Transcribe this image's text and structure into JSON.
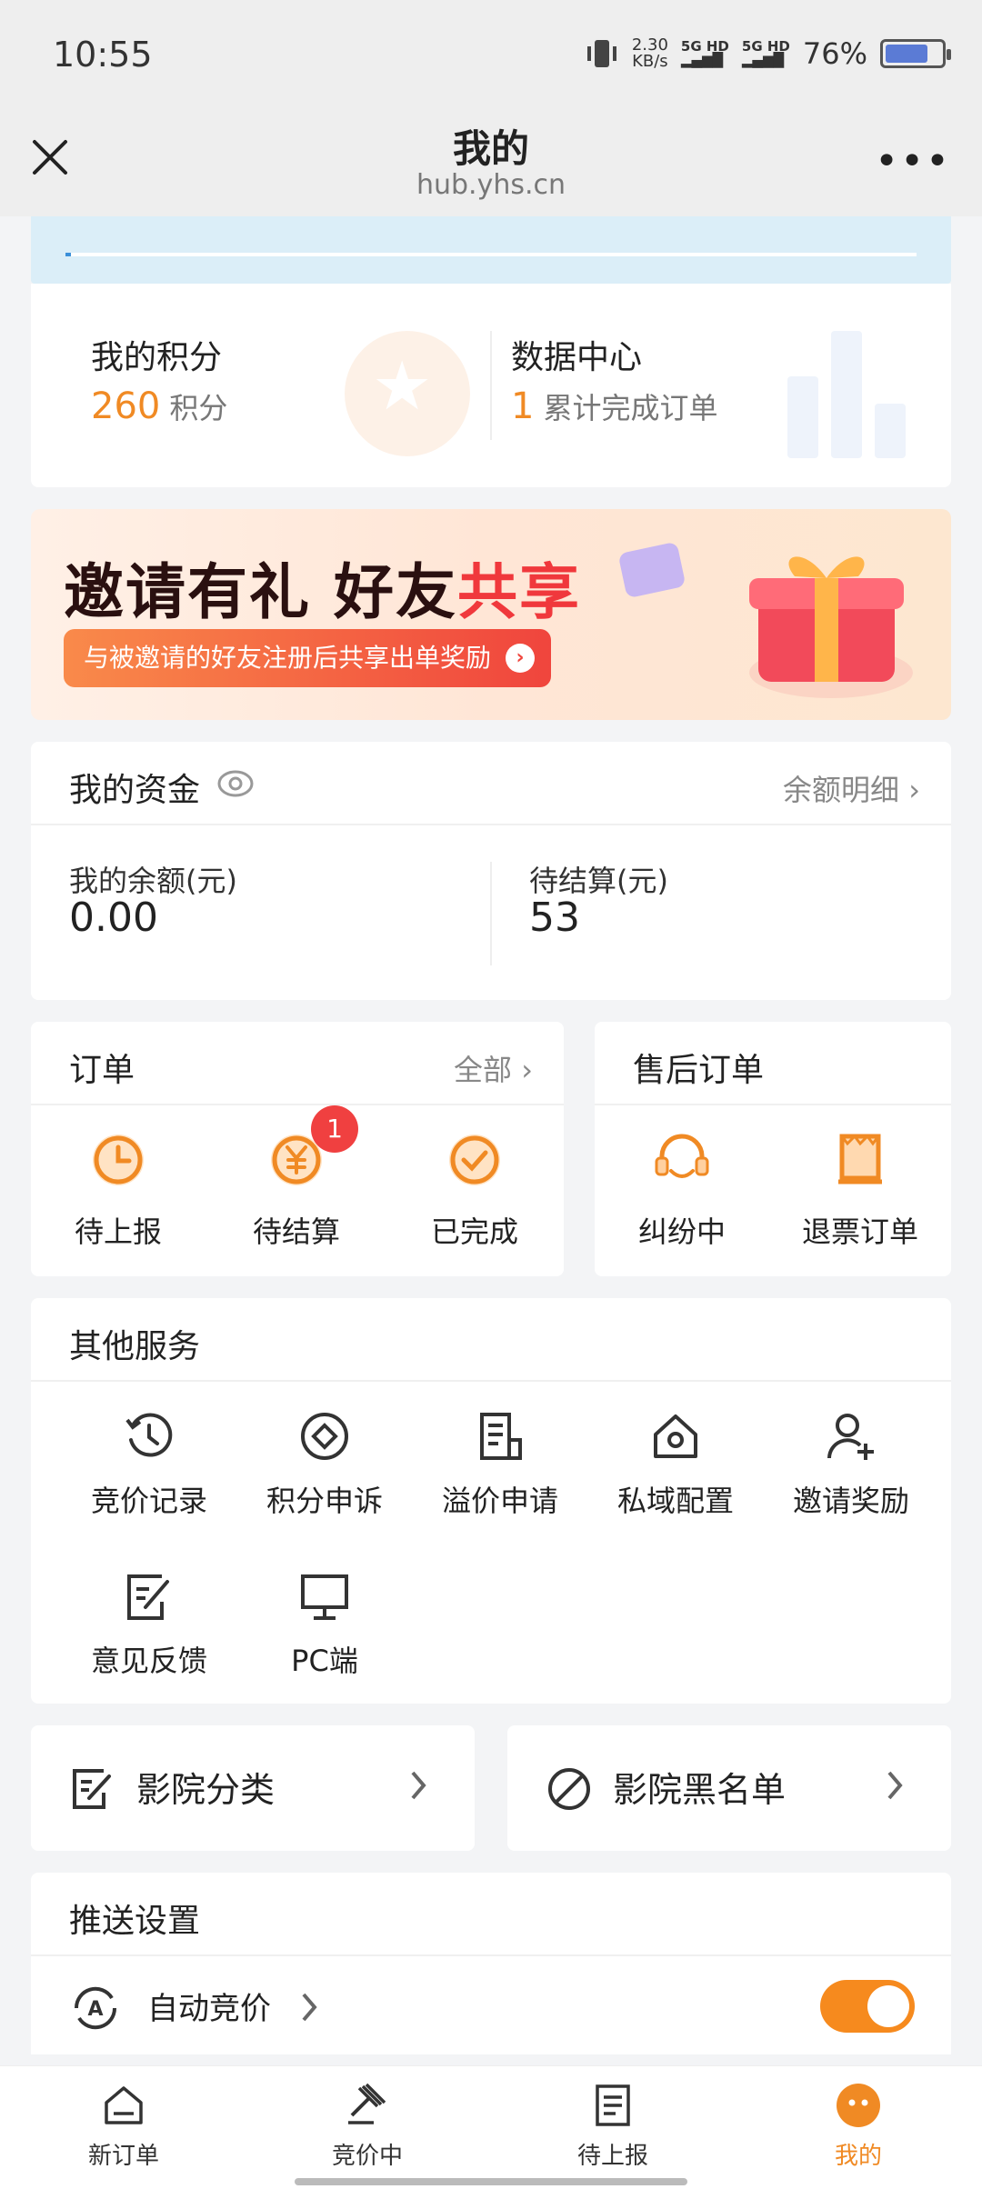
{
  "status_bar": {
    "time": "10:55",
    "net_speed": "2.30",
    "net_unit": "KB/s",
    "signal1": "5G HD",
    "signal2": "5G HD",
    "battery": "76%",
    "battery_level": 0.76
  },
  "title_bar": {
    "title": "我的",
    "subtitle": "hub.yhs.cn"
  },
  "points": {
    "title": "我的积分",
    "value": "260",
    "unit": "积分"
  },
  "data_center": {
    "title": "数据中心",
    "value": "1",
    "desc": "累计完成订单"
  },
  "banner": {
    "head_black": "邀请有礼 好友",
    "head_red": "共享",
    "pill": "与被邀请的好友注册后共享出单奖励"
  },
  "funds": {
    "title": "我的资金",
    "detail_link": "余额明细",
    "balance_label": "我的余额(元)",
    "balance_value": "0.00",
    "pending_label": "待结算(元)",
    "pending_value": "53"
  },
  "orders": {
    "title": "订单",
    "all_link": "全部",
    "items": [
      {
        "label": "待上报"
      },
      {
        "label": "待结算",
        "badge": "1"
      },
      {
        "label": "已完成"
      }
    ]
  },
  "after_sales": {
    "title": "售后订单",
    "items": [
      {
        "label": "纠纷中"
      },
      {
        "label": "退票订单"
      }
    ]
  },
  "services": {
    "title": "其他服务",
    "items": [
      {
        "label": "竞价记录",
        "icon": "history-icon"
      },
      {
        "label": "积分申诉",
        "icon": "diamond-icon"
      },
      {
        "label": "溢价申请",
        "icon": "document-icon"
      },
      {
        "label": "私域配置",
        "icon": "home-gear-icon"
      },
      {
        "label": "邀请奖励",
        "icon": "add-user-icon"
      },
      {
        "label": "意见反馈",
        "icon": "edit-note-icon"
      },
      {
        "label": "PC端",
        "icon": "monitor-icon"
      }
    ]
  },
  "cinema": {
    "category": "影院分类",
    "blacklist": "影院黑名单"
  },
  "push": {
    "title": "推送设置",
    "auto_bid": "自动竞价",
    "auto_bid_on": true
  },
  "tabs": [
    {
      "label": "新订单",
      "icon": "inbox-icon"
    },
    {
      "label": "竞价中",
      "icon": "gavel-icon"
    },
    {
      "label": "待上报",
      "icon": "report-icon"
    },
    {
      "label": "我的",
      "icon": "profile-icon",
      "active": true
    }
  ],
  "colors": {
    "accent": "#f08a24",
    "badge": "#f04040",
    "banner_red": "#f0383c"
  }
}
